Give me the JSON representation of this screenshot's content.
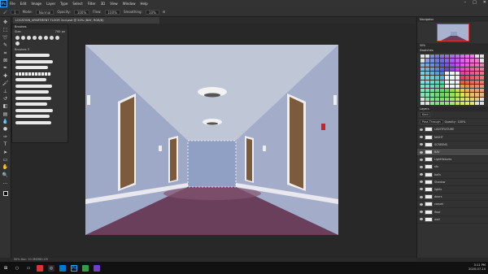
{
  "menubar": {
    "items": [
      "File",
      "Edit",
      "Image",
      "Layer",
      "Type",
      "Select",
      "Filter",
      "3D",
      "View",
      "Window",
      "Help"
    ]
  },
  "options": {
    "brush_size": "1",
    "mode_label": "Mode:",
    "mode_value": "Normal",
    "opacity_label": "Opacity:",
    "opacity_value": "100%",
    "flow_label": "Flow:",
    "flow_value": "100%",
    "smoothing_label": "Smoothing:"
  },
  "document": {
    "tab_title": "LOCATION_APARTMENT FLOOR 2nd.psd @ 50% (BAY, RGB/8)",
    "status": "50%   Doc: 10.3M/980.1M"
  },
  "brush_panel": {
    "title": "Brushes",
    "size_label": "Size:",
    "size_value": "700 px",
    "group": "Brushes 3"
  },
  "panels": {
    "navigator": "Navigator",
    "swatches": "Swatches",
    "layers": "Layers",
    "zoom": "50%"
  },
  "layers": {
    "search_placeholder": "Kind",
    "blend_mode": "Pass Through",
    "opacity_label": "Opacity:",
    "opacity_value": "100%",
    "fill_label": "Fill:",
    "fill_value": "100%",
    "items": [
      "LIGHTFIXTURE",
      "NIGHT",
      "SCREENS",
      "BAY",
      "Lightfixtures",
      "sfx",
      "balls",
      "Shadow",
      "lights",
      "doors",
      "carpet",
      "floor",
      "wall"
    ]
  },
  "taskbar": {
    "time": "3:11 PM",
    "date": "2020-07-14"
  },
  "colors": {
    "accent": "#31a8ff",
    "panel": "#323232",
    "canvas_wall": "#a7b3cf",
    "carpet": "#6a3f5c"
  }
}
